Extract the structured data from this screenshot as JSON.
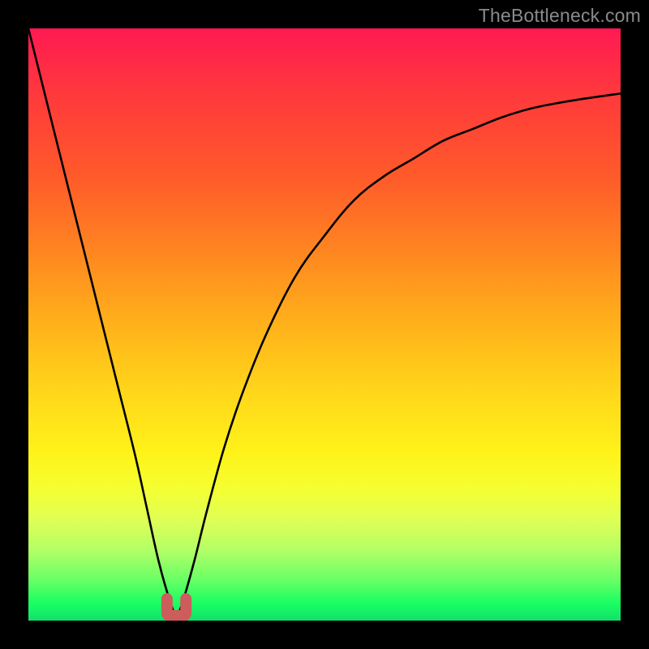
{
  "watermark": "TheBottleneck.com",
  "chart_data": {
    "type": "line",
    "title": "",
    "xlabel": "",
    "ylabel": "",
    "xlim": [
      0,
      100
    ],
    "ylim": [
      0,
      100
    ],
    "series": [
      {
        "name": "bottleneck-curve",
        "x": [
          0,
          3,
          6,
          9,
          12,
          15,
          18,
          20,
          22,
          24,
          25,
          26,
          28,
          30,
          33,
          36,
          40,
          45,
          50,
          55,
          60,
          65,
          70,
          75,
          80,
          85,
          90,
          95,
          100
        ],
        "y": [
          100,
          88,
          76,
          64,
          52,
          40,
          28,
          19,
          10,
          3,
          1,
          3,
          10,
          18,
          29,
          38,
          48,
          58,
          65,
          71,
          75,
          78,
          81,
          83,
          85,
          86.5,
          87.5,
          88.3,
          89
        ]
      }
    ],
    "notch": {
      "x_center": 25,
      "width": 3.2,
      "depth": 3.4,
      "color": "#cd5c5c"
    },
    "colors": {
      "curve": "#000000",
      "notch": "#cd5c5c",
      "frame": "#000000"
    }
  }
}
